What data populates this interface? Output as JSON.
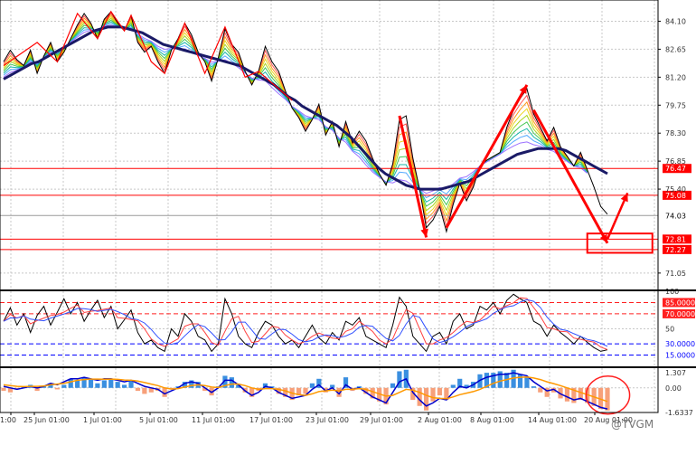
{
  "chart_data": {
    "type": "line",
    "description_free": true,
    "price_pane": {
      "ylim": [
        70.2,
        85.2
      ],
      "y_ticks": [
        "84.10",
        "82.65",
        "81.20",
        "79.75",
        "78.30",
        "76.85",
        "75.40",
        "71.05"
      ],
      "price_series": [
        82.0,
        82.6,
        82.1,
        81.8,
        82.6,
        81.4,
        82.3,
        83.0,
        82.0,
        82.5,
        83.2,
        83.9,
        84.5,
        84.0,
        83.2,
        84.2,
        84.6,
        84.0,
        83.6,
        84.4,
        83.0,
        82.5,
        82.8,
        82.0,
        81.4,
        82.6,
        83.2,
        84.0,
        83.4,
        82.5,
        82.0,
        81.0,
        82.2,
        83.7,
        82.9,
        82.5,
        81.5,
        80.8,
        81.5,
        82.8,
        82.0,
        81.5,
        80.5,
        79.6,
        79.1,
        78.4,
        79.0,
        79.8,
        78.2,
        78.9,
        77.6,
        78.9,
        77.8,
        78.4,
        77.9,
        77.0,
        76.2,
        75.6,
        76.7,
        79.0,
        79.2,
        77.0,
        75.4,
        73.4,
        73.8,
        74.5,
        73.2,
        74.6,
        75.7,
        74.8,
        75.5,
        76.6,
        76.9,
        77.1,
        77.3,
        78.6,
        79.5,
        80.1,
        80.6,
        79.3,
        78.6,
        77.9,
        78.6,
        77.6,
        77.1,
        76.6,
        77.3,
        76.4,
        75.5,
        74.5,
        74.1
      ],
      "ma_series": [
        81.1,
        81.3,
        81.5,
        81.7,
        81.9,
        82.0,
        82.2,
        82.4,
        82.6,
        82.8,
        83.0,
        83.2,
        83.4,
        83.6,
        83.7,
        83.8,
        83.8,
        83.8,
        83.7,
        83.6,
        83.5,
        83.3,
        83.1,
        82.9,
        82.8,
        82.7,
        82.6,
        82.5,
        82.4,
        82.3,
        82.2,
        82.1,
        82.0,
        81.9,
        81.8,
        81.6,
        81.4,
        81.2,
        81.0,
        80.8,
        80.5,
        80.2,
        80.0,
        79.7,
        79.5,
        79.3,
        79.1,
        78.9,
        78.7,
        78.4,
        78.1,
        77.7,
        77.3,
        76.9,
        76.5,
        76.2,
        76.0,
        75.8,
        75.6,
        75.5,
        75.4,
        75.4,
        75.4,
        75.4,
        75.5,
        75.6,
        75.7,
        75.8,
        76.0,
        76.2,
        76.4,
        76.6,
        76.8,
        77.0,
        77.2,
        77.3,
        77.4,
        77.5,
        77.5,
        77.5,
        77.5,
        77.4,
        77.2,
        77.0,
        76.8,
        76.6,
        76.4,
        76.2
      ],
      "horizontal_levels": [
        {
          "label": "76.47",
          "value": 76.47,
          "color": "#ff0000"
        },
        {
          "label": "75.08",
          "value": 75.08,
          "color": "#ff0000"
        },
        {
          "label": "74.03",
          "value": 74.03,
          "color": "#9a9a9a"
        },
        {
          "label": "72.81",
          "value": 72.81,
          "color": "#ff0000"
        },
        {
          "label": "72.27",
          "value": 72.27,
          "color": "#ff0000"
        }
      ],
      "arrows_color": "#ff0000",
      "ma_color": "#1a1a66"
    },
    "oscillator_pane": {
      "ylim": [
        0,
        100
      ],
      "y_ticks": [
        "100",
        "85.0000",
        "70.0000",
        "50",
        "30.0000",
        "15.0000"
      ],
      "levels": [
        {
          "label": "85.0000",
          "value": 85,
          "color": "#ff2020"
        },
        {
          "label": "70.0000",
          "value": 70,
          "color": "#ff2020"
        },
        {
          "label": "30.0000",
          "value": 30,
          "color": "#0000ff"
        },
        {
          "label": "15.0000",
          "value": 15,
          "color": "#0000ff"
        }
      ],
      "tick_50": 50,
      "series_k": [
        60,
        78,
        55,
        70,
        45,
        68,
        80,
        55,
        72,
        90,
        70,
        85,
        60,
        75,
        88,
        65,
        80,
        50,
        62,
        75,
        45,
        30,
        35,
        25,
        20,
        50,
        40,
        70,
        60,
        40,
        35,
        20,
        30,
        90,
        70,
        40,
        30,
        25,
        45,
        60,
        55,
        40,
        30,
        35,
        25,
        40,
        55,
        38,
        30,
        45,
        35,
        60,
        55,
        65,
        40,
        35,
        30,
        25,
        55,
        92,
        80,
        40,
        30,
        20,
        40,
        45,
        30,
        60,
        70,
        50,
        55,
        80,
        75,
        85,
        70,
        88,
        96,
        90,
        85,
        60,
        55,
        40,
        55,
        45,
        38,
        30,
        40,
        32,
        25,
        20,
        22
      ]
    },
    "macd_pane": {
      "ylim": [
        -1.6337,
        1.307
      ],
      "y_ticks": [
        "1.307",
        "0.00",
        "-1.6337"
      ],
      "histogram": [
        -0.2,
        -0.3,
        -0.1,
        0.1,
        0.2,
        -0.2,
        0.1,
        0.3,
        -0.1,
        0.2,
        0.6,
        0.5,
        0.7,
        0.6,
        0.3,
        0.5,
        0.6,
        0.4,
        0.2,
        0.5,
        -0.2,
        -0.4,
        -0.3,
        -0.2,
        -0.6,
        -0.1,
        0.1,
        0.4,
        0.5,
        0.4,
        -0.2,
        -0.5,
        0.1,
        0.8,
        0.7,
        0.2,
        -0.3,
        -0.6,
        -0.2,
        0.3,
        0.1,
        -0.4,
        -0.6,
        -0.8,
        -0.5,
        -0.4,
        0.3,
        0.6,
        -0.3,
        0.2,
        -0.6,
        0.7,
        -0.2,
        0.1,
        -0.4,
        -0.7,
        -0.9,
        -1.1,
        0.3,
        1.1,
        1.2,
        -0.8,
        -1.2,
        -1.5,
        -0.9,
        -0.5,
        -0.8,
        0.2,
        0.6,
        0.2,
        0.4,
        0.9,
        1.0,
        1.0,
        1.1,
        1.0,
        1.2,
        0.9,
        0.7,
        0.1,
        -0.3,
        -0.6,
        -0.3,
        -0.7,
        -0.9,
        -1.0,
        -0.8,
        -1.0,
        -1.2,
        -1.4,
        -1.5
      ],
      "macd_line": [
        0.1,
        0.0,
        -0.1,
        0.0,
        0.1,
        0.0,
        0.1,
        0.3,
        0.2,
        0.4,
        0.6,
        0.6,
        0.7,
        0.6,
        0.5,
        0.6,
        0.6,
        0.5,
        0.4,
        0.5,
        0.3,
        0.1,
        0.0,
        -0.1,
        -0.4,
        -0.2,
        0.0,
        0.3,
        0.4,
        0.3,
        0.0,
        -0.3,
        0.0,
        0.5,
        0.5,
        0.2,
        -0.2,
        -0.5,
        -0.3,
        0.1,
        0.0,
        -0.3,
        -0.5,
        -0.7,
        -0.6,
        -0.5,
        -0.1,
        0.2,
        -0.2,
        0.0,
        -0.4,
        0.2,
        -0.1,
        0.0,
        -0.3,
        -0.6,
        -0.8,
        -1.0,
        -0.3,
        0.4,
        0.6,
        -0.3,
        -0.8,
        -1.2,
        -1.0,
        -0.7,
        -0.8,
        -0.3,
        0.1,
        0.0,
        0.2,
        0.5,
        0.7,
        0.8,
        0.9,
        0.9,
        1.0,
        0.9,
        0.8,
        0.4,
        0.1,
        -0.2,
        -0.1,
        -0.4,
        -0.6,
        -0.8,
        -0.7,
        -0.9,
        -1.1,
        -1.3,
        -1.4
      ],
      "signal_line": [
        0.2,
        0.15,
        0.1,
        0.08,
        0.1,
        0.1,
        0.12,
        0.2,
        0.25,
        0.3,
        0.4,
        0.5,
        0.55,
        0.58,
        0.58,
        0.57,
        0.58,
        0.56,
        0.52,
        0.5,
        0.45,
        0.35,
        0.25,
        0.15,
        0.0,
        -0.08,
        -0.05,
        0.05,
        0.15,
        0.2,
        0.15,
        0.05,
        0.02,
        0.15,
        0.25,
        0.25,
        0.15,
        0.0,
        -0.1,
        -0.05,
        -0.05,
        -0.1,
        -0.2,
        -0.35,
        -0.45,
        -0.5,
        -0.4,
        -0.25,
        -0.2,
        -0.15,
        -0.2,
        -0.1,
        -0.1,
        -0.05,
        -0.1,
        -0.25,
        -0.4,
        -0.55,
        -0.5,
        -0.3,
        -0.1,
        -0.15,
        -0.3,
        -0.5,
        -0.65,
        -0.7,
        -0.72,
        -0.6,
        -0.45,
        -0.35,
        -0.25,
        -0.1,
        0.1,
        0.3,
        0.45,
        0.55,
        0.65,
        0.7,
        0.72,
        0.65,
        0.55,
        0.4,
        0.28,
        0.15,
        0.0,
        -0.15,
        -0.3,
        -0.45,
        -0.6,
        -0.75,
        -0.9
      ],
      "circle_color": "#ff2020"
    },
    "x_ticks": [
      "1:00",
      "25 Jun 01:00",
      "1 Jul 01:00",
      "5 Jul 01:00",
      "11 Jul 01:00",
      "17 Jul 01:00",
      "23 Jul 01:00",
      "29 Jul 01:00",
      "2 Aug 01:00",
      "8 Aug 01:00",
      "14 Aug 01:00",
      "20 Aug 01:00"
    ],
    "watermark": "@TVGM"
  }
}
